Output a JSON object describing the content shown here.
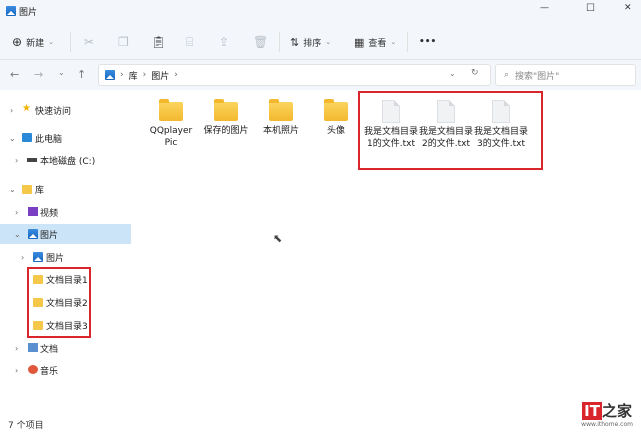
{
  "window": {
    "title": "图片",
    "controls": {
      "minimize": "—",
      "maximize": "☐",
      "close": "✕"
    }
  },
  "toolbar": {
    "new_label": "新建",
    "sort_label": "排序",
    "view_label": "查看",
    "more": "•••"
  },
  "address": {
    "breadcrumb": [
      "库",
      "图片"
    ],
    "search_placeholder": "搜索\"图片\""
  },
  "sidebar": {
    "items": [
      {
        "label": "快速访问"
      },
      {
        "label": "此电脑"
      },
      {
        "label": "本地磁盘 (C:)"
      },
      {
        "label": "库"
      },
      {
        "label": "视频"
      },
      {
        "label": "图片"
      },
      {
        "label": "图片"
      },
      {
        "label": "文档目录1"
      },
      {
        "label": "文档目录2"
      },
      {
        "label": "文档目录3"
      },
      {
        "label": "文档"
      },
      {
        "label": "音乐"
      }
    ]
  },
  "files": [
    {
      "name": "QQplayer Pic",
      "type": "folder"
    },
    {
      "name": "保存的图片",
      "type": "folder"
    },
    {
      "name": "本机照片",
      "type": "folder"
    },
    {
      "name": "头像",
      "type": "folder"
    },
    {
      "name": "我是文档目录1的文件.txt",
      "type": "txt"
    },
    {
      "name": "我是文档目录2的文件.txt",
      "type": "txt"
    },
    {
      "name": "我是文档目录3的文件.txt",
      "type": "txt"
    }
  ],
  "status": {
    "count": "7 个项目"
  },
  "watermark": {
    "logo": "IT之家",
    "url": "www.ithome.com"
  },
  "colors": {
    "accent": "#0067c0",
    "highlight": "#d9262c",
    "selected": "#cce4f7"
  }
}
